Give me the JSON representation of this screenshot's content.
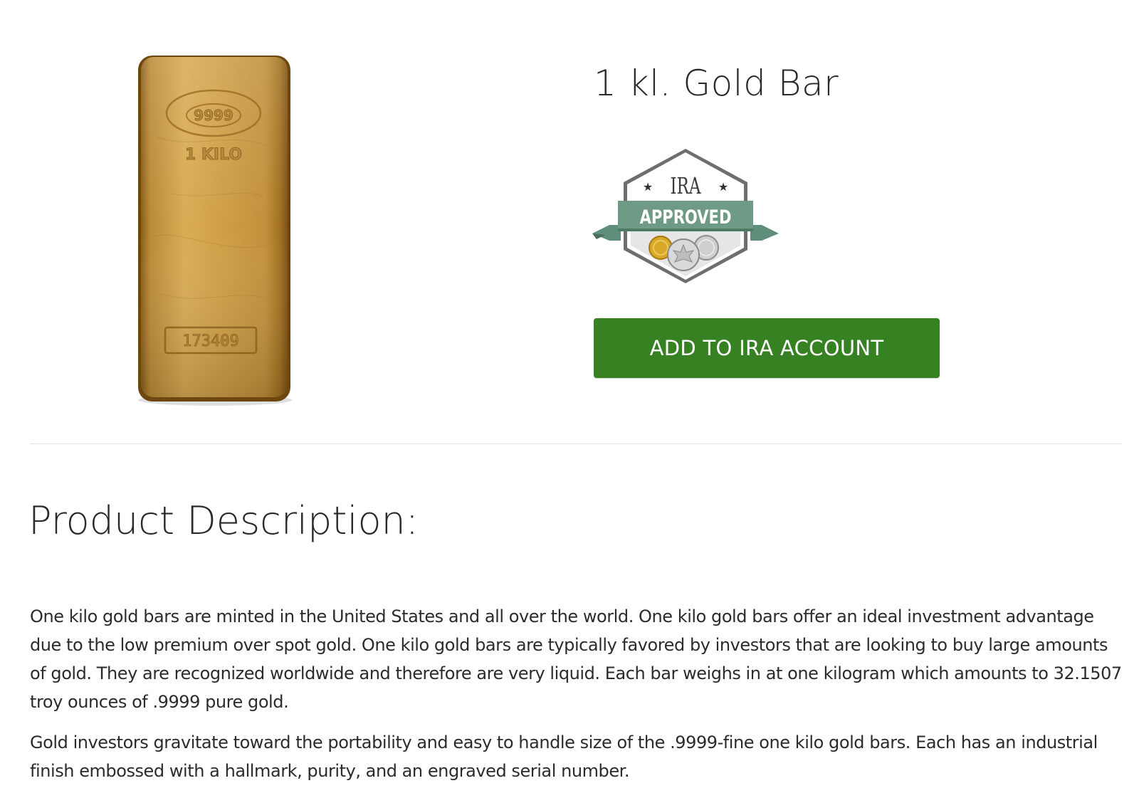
{
  "product": {
    "title": "1 kl. Gold Bar",
    "image_icon": "gold-bar-image",
    "bar_stamp": {
      "purity": "9999",
      "weight": "1 KILO",
      "serial": "173409"
    }
  },
  "badge": {
    "line1": "IRA",
    "line2": "APPROVED",
    "icon": "ira-approved-badge-icon"
  },
  "actions": {
    "add_to_ira": "ADD TO IRA ACCOUNT"
  },
  "description": {
    "heading": "Product Description:",
    "paragraphs": [
      "One kilo gold bars are minted in the United States and all over the world. One kilo gold bars offer an ideal investment advantage due to the low premium over spot gold. One kilo gold bars are typically favored by investors that are looking to buy large amounts of gold. They are recognized worldwide and therefore are very liquid. Each bar weighs in at one kilogram which amounts to 32.1507 troy ounces of .9999 pure gold.",
      "Gold investors gravitate toward the portability and easy to handle size of the .9999-fine one kilo gold bars. Each has an industrial finish embossed with a hallmark, purity, and an engraved serial number."
    ]
  },
  "colors": {
    "button": "#368122",
    "gold_light": "#d8a94a",
    "gold_dark": "#9a6a1c",
    "ribbon": "#5f8f7a"
  }
}
